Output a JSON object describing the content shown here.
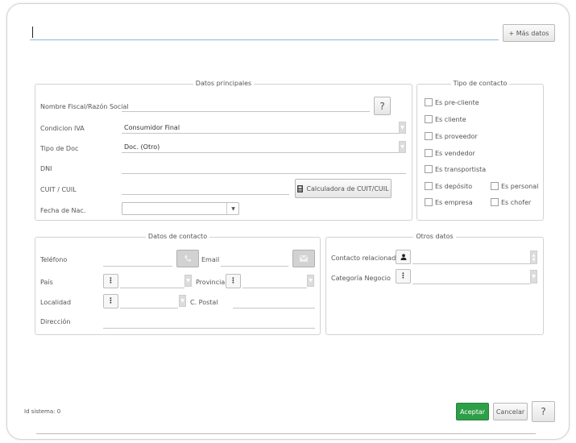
{
  "toolbar": {
    "more_data_label": "+ Más datos"
  },
  "main_data": {
    "legend": "Datos principales",
    "fiscal_name_label": "Nombre Fiscal/Razón Social",
    "help_glyph": "?",
    "iva_label": "Condicion IVA",
    "iva_value": "Consumidor Final",
    "doc_type_label": "Tipo de Doc",
    "doc_type_value": "Doc. (Otro)",
    "dni_label": "DNI",
    "cuit_label": "CUIT / CUIL",
    "calc_button_label": "Calculadora de CUIT/CUIL",
    "birth_label": "Fecha de Nac."
  },
  "contact_type": {
    "legend": "Tipo de contacto",
    "items": [
      "Es pre-cliente",
      "Es cliente",
      "Es proveedor",
      "Es vendedor",
      "Es transportista",
      "Es depósito",
      "Es personal",
      "Es empresa",
      "Es chofer"
    ]
  },
  "contact_data": {
    "legend": "Datos de contacto",
    "phone_label": "Teléfono",
    "email_label": "Email",
    "country_label": "País",
    "province_label": "Provincia",
    "city_label": "Localidad",
    "postal_label": "C. Postal",
    "address_label": "Dirección"
  },
  "other_data": {
    "legend": "Otros datos",
    "related_contact_label": "Contacto relacionado",
    "business_category_label": "Categoría Negocio"
  },
  "footer": {
    "system_id": "Id sistema: 0",
    "accept_label": "Aceptar",
    "cancel_label": "Cancelar",
    "help_glyph": "?"
  },
  "colors": {
    "accept": "#2e9f47",
    "focus_underline": "#8ab8e6"
  },
  "icons": {
    "calculator": "calculator-icon",
    "phone": "phone-icon",
    "email": "envelope-icon",
    "user": "user-icon",
    "ellipsis": "vertical-ellipsis-icon",
    "dropdown": "chevron-down-icon"
  }
}
